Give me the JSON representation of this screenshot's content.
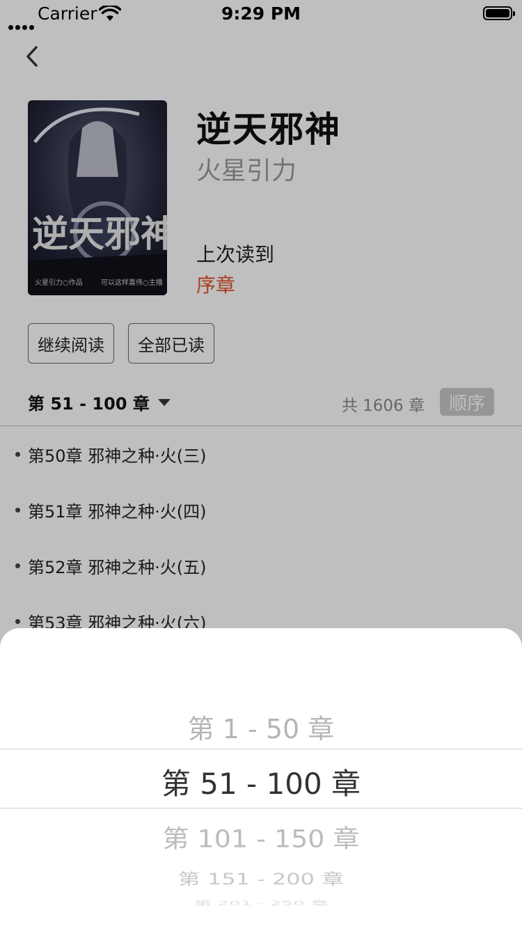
{
  "status_bar": {
    "carrier": "Carrier",
    "time": "9:29 PM"
  },
  "book": {
    "title": "逆天邪神",
    "author": "火星引力",
    "last_read_label": "上次读到",
    "last_read_chapter": "序章",
    "cover_caption_left": "火星引力○作品",
    "cover_caption_right": "可以这样嘉伟○主播"
  },
  "buttons": {
    "continue_reading": "继续阅读",
    "mark_all_read": "全部已读"
  },
  "range": {
    "current": "第 51 - 100 章",
    "total": "共 1606 章",
    "order": "顺序"
  },
  "chapters": [
    "第50章 邪神之种·火(三)",
    "第51章 邪神之种·火(四)",
    "第52章 邪神之种·火(五)",
    "第53章 邪神之种·火(六)"
  ],
  "picker": {
    "options": [
      "第 1 - 50 章",
      "第 51 - 100 章",
      "第 101 - 150 章",
      "第 151 - 200 章",
      "第 201 - 250 章"
    ],
    "selected_index": 1
  }
}
